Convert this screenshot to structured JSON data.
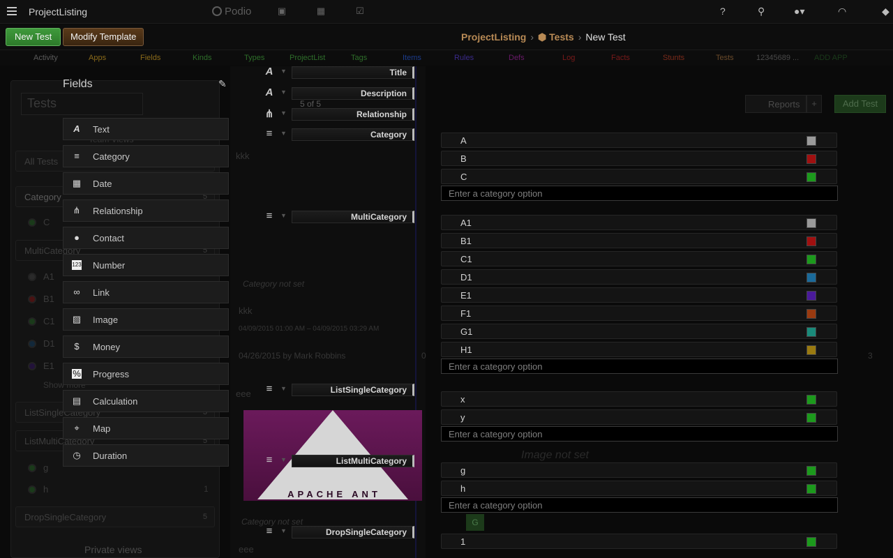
{
  "topbar": {
    "app_title": "ProjectListing",
    "logo_text": "Podio",
    "help_label": "?"
  },
  "toolbar": {
    "new_label": "New Test",
    "modify_label": "Modify Template",
    "crumb_workspace": "ProjectListing",
    "crumb_app": "Tests",
    "crumb_current": "New Test"
  },
  "nav": [
    {
      "label": "Activity",
      "color": "#5a5a5a"
    },
    {
      "label": "Apps",
      "color": "#8a6a1a"
    },
    {
      "label": "Fields",
      "color": "#8a6a1a"
    },
    {
      "label": "Kinds",
      "color": "#2e6e2a"
    },
    {
      "label": "Types",
      "color": "#2e6e2a"
    },
    {
      "label": "ProjectList",
      "color": "#2e6e2a"
    },
    {
      "label": "Tags",
      "color": "#2e6e2a"
    },
    {
      "label": "Items",
      "color": "#1c3c8c"
    },
    {
      "label": "Rules",
      "color": "#3a2a8a"
    },
    {
      "label": "Defs",
      "color": "#6a1a6a"
    },
    {
      "label": "Log",
      "color": "#7a1a1a"
    },
    {
      "label": "Facts",
      "color": "#7a1a1a"
    },
    {
      "label": "Stunts",
      "color": "#7a2a1a"
    },
    {
      "label": "Tests",
      "color": "#6a4a2a"
    },
    {
      "label": "12345689 ...",
      "color": "#4a4a4a"
    },
    {
      "label": "ADD APP",
      "color": "#1a3a1a"
    }
  ],
  "left_panel": {
    "search_text": "Tests",
    "team_views": "Team Views",
    "all_tests": "All Tests",
    "category": "Category",
    "category_count": "5",
    "c_label": "C",
    "multicategory": "MultiCategory",
    "multi_count": "5",
    "multi_items": [
      "A1",
      "B1",
      "C1",
      "D1",
      "E1"
    ],
    "show_more": "Show more",
    "list_single": "ListSingleCategory",
    "list_single_count": "3",
    "list_multi": "ListMultiCategory",
    "list_multi_count": "5",
    "g_label": "g",
    "h_label": "h",
    "h_count": "1",
    "drop_single": "DropSingleCategory",
    "drop_single_count": "5",
    "private_views": "Private views"
  },
  "fields_panel": {
    "title": "Fields",
    "items": [
      {
        "label": "Text",
        "icon": "text-icon",
        "glyph": "A"
      },
      {
        "label": "Category",
        "icon": "category-icon",
        "glyph": "≡"
      },
      {
        "label": "Date",
        "icon": "calendar-icon",
        "glyph": "▦"
      },
      {
        "label": "Relationship",
        "icon": "relationship-icon",
        "glyph": "⋔"
      },
      {
        "label": "Contact",
        "icon": "contact-icon",
        "glyph": "●"
      },
      {
        "label": "Number",
        "icon": "number-icon",
        "glyph": "123"
      },
      {
        "label": "Link",
        "icon": "link-icon",
        "glyph": "∞"
      },
      {
        "label": "Image",
        "icon": "image-icon",
        "glyph": "▨"
      },
      {
        "label": "Money",
        "icon": "money-icon",
        "glyph": "$"
      },
      {
        "label": "Progress",
        "icon": "progress-icon",
        "glyph": "%"
      },
      {
        "label": "Calculation",
        "icon": "calculation-icon",
        "glyph": "▤"
      },
      {
        "label": "Map",
        "icon": "map-icon",
        "glyph": "⌖"
      },
      {
        "label": "Duration",
        "icon": "clock-icon",
        "glyph": "◷"
      }
    ]
  },
  "template_fields": {
    "title": "Title",
    "description": "Description",
    "relationship": "Relationship",
    "category": "Category",
    "multicategory": "MultiCategory",
    "list_single": "ListSingleCategory",
    "list_multi": "ListMultiCategory",
    "drop_single": "DropSingleCategory"
  },
  "category_options": {
    "placeholder": "Enter a category option",
    "category": [
      {
        "label": "A",
        "color": "#9a9a9a"
      },
      {
        "label": "B",
        "color": "#a01010"
      },
      {
        "label": "C",
        "color": "#1c9a1c"
      }
    ],
    "multicategory": [
      {
        "label": "A1",
        "color": "#9a9a9a"
      },
      {
        "label": "B1",
        "color": "#a01010"
      },
      {
        "label": "C1",
        "color": "#1c9a1c"
      },
      {
        "label": "D1",
        "color": "#1a6a9a"
      },
      {
        "label": "E1",
        "color": "#4a1a9a"
      },
      {
        "label": "F1",
        "color": "#9a3a10"
      },
      {
        "label": "G1",
        "color": "#1a8a7a"
      },
      {
        "label": "H1",
        "color": "#9a7a10"
      }
    ],
    "list_single": [
      {
        "label": "x",
        "color": "#1c9a1c"
      },
      {
        "label": "y",
        "color": "#1c9a1c"
      }
    ],
    "list_multi": [
      {
        "label": "g",
        "color": "#1c9a1c"
      },
      {
        "label": "h",
        "color": "#1c9a1c"
      }
    ],
    "drop_single": [
      {
        "label": "1",
        "color": "#1c9a1c"
      }
    ]
  },
  "faded": {
    "counter": "5 of 5",
    "kkk": "kkk",
    "kkk2": "kkk",
    "category_not_set": "Category not set",
    "category_not_set2": "Category not set",
    "dates": "04/09/2015 01:00 AM  –  04/09/2015 03:29 AM",
    "created": "04/26/2015 by Mark Robbins",
    "comments": "0",
    "comments2": "3",
    "eee": "eee",
    "eee2": "eee",
    "image_not_set": "Image not set",
    "reports": "Reports",
    "add_test": "Add Test",
    "ant_text": "APACHE ANT",
    "g_tag": "G"
  }
}
